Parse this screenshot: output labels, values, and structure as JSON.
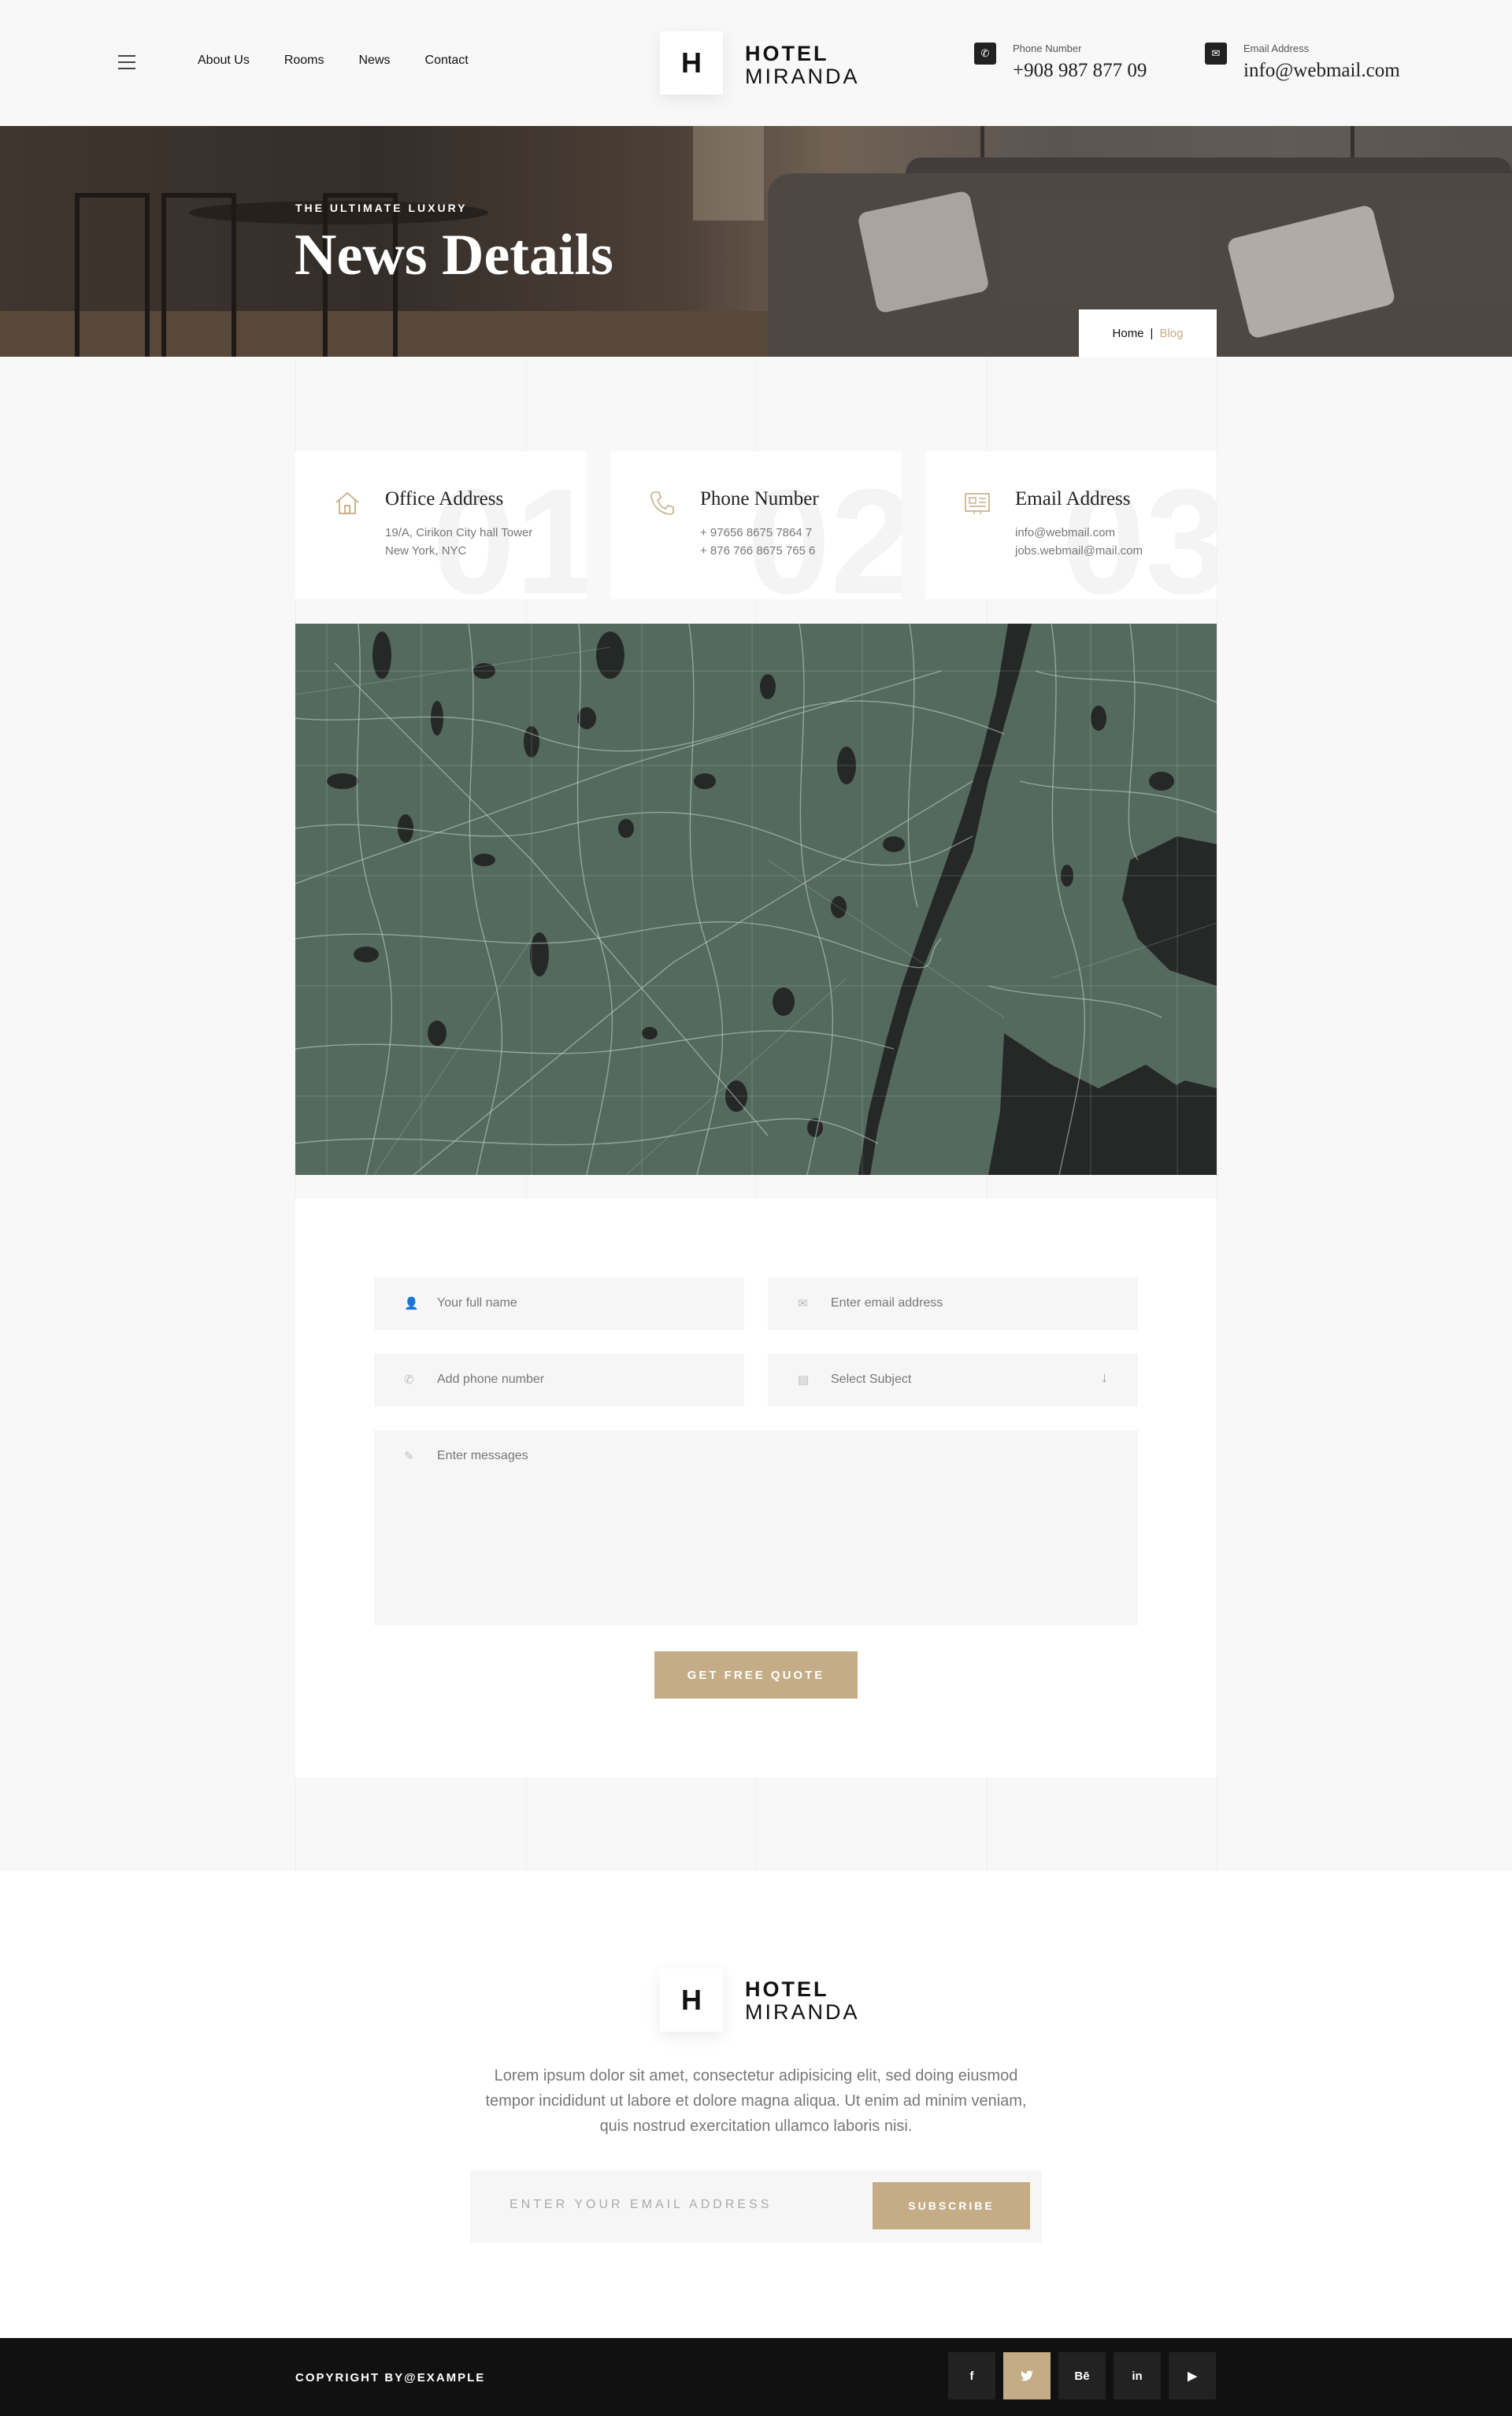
{
  "header": {
    "nav": [
      "About Us",
      "Rooms",
      "News",
      "Contact"
    ],
    "logo_letter": "H",
    "logo_line1": "HOTEL",
    "logo_line2": "MIRANDA",
    "phone_label": "Phone Number",
    "phone_value": "+908 987 877 09",
    "email_label": "Email Address",
    "email_value": "info@webmail.com"
  },
  "hero": {
    "eyebrow": "THE ULTIMATE LUXURY",
    "title": "News Details",
    "breadcrumb_home": "Home",
    "breadcrumb_sep": "|",
    "breadcrumb_current": "Blog"
  },
  "cards": [
    {
      "number": "01",
      "icon": "home-icon",
      "title": "Office Address",
      "lines": [
        "19/A, Cirikon City hall Tower",
        "New York, NYC"
      ]
    },
    {
      "number": "02",
      "icon": "phone-icon",
      "title": "Phone Number",
      "lines": [
        "+ 97656 8675 7864 7",
        "+ 876 766 8675 765 6"
      ]
    },
    {
      "number": "03",
      "icon": "newspaper-icon",
      "title": "Email Address",
      "lines": [
        "info@webmail.com",
        "jobs.webmail@mail.com"
      ]
    }
  ],
  "form": {
    "name_placeholder": "Your full name",
    "email_placeholder": "Enter email address",
    "phone_placeholder": "Add phone number",
    "subject_placeholder": "Select Subject",
    "message_placeholder": "Enter messages",
    "submit_label": "GET FREE QUOTE"
  },
  "footer": {
    "description": "Lorem ipsum dolor sit amet, consectetur adipisicing elit, sed doing eiusmod tempor incididunt ut labore et dolore magna aliqua. Ut enim ad minim veniam, quis nostrud exercitation ullamco laboris nisi.",
    "newsletter_placeholder": "ENTER YOUR EMAIL ADDRESS",
    "subscribe_label": "SUBSCRIBE",
    "copyright": "COPYRIGHT BY@EXAMPLE",
    "socials": [
      {
        "icon": "facebook-icon",
        "glyph": "f"
      },
      {
        "icon": "twitter-icon",
        "glyph": "🐦"
      },
      {
        "icon": "behance-icon",
        "glyph": "Bē"
      },
      {
        "icon": "linkedin-icon",
        "glyph": "in"
      },
      {
        "icon": "youtube-icon",
        "glyph": "▶"
      }
    ]
  },
  "colors": {
    "accent": "#c4ad86",
    "dark": "#111111",
    "map_land": "#556a5f",
    "map_water": "#252827"
  }
}
